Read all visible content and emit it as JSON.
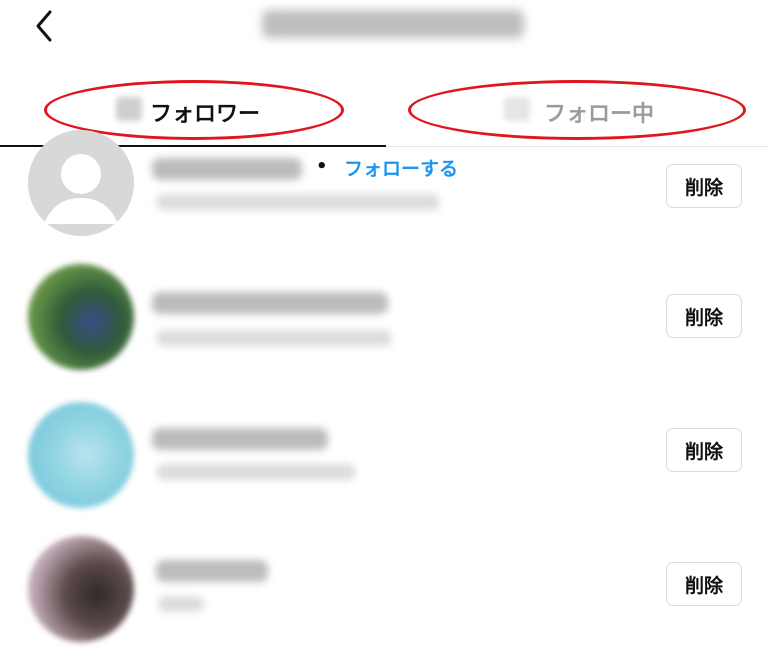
{
  "header": {
    "back_icon": "chevron-left-icon",
    "username_blurred": true
  },
  "tabs": {
    "followers": {
      "label": "フォロワー",
      "active": true
    },
    "following": {
      "label": "フォロー中",
      "active": false
    },
    "highlight_color": "#e0161d"
  },
  "rows": [
    {
      "avatar": "default-avatar",
      "follow_label": "フォローする",
      "remove_label": "削除"
    },
    {
      "avatar": "photo-green",
      "remove_label": "削除"
    },
    {
      "avatar": "photo-lightblue",
      "remove_label": "削除"
    },
    {
      "avatar": "photo-dark",
      "remove_label": "削除"
    }
  ],
  "colors": {
    "link": "#1b95f0",
    "active_text": "#111111",
    "inactive_text": "#9b9b9b"
  }
}
